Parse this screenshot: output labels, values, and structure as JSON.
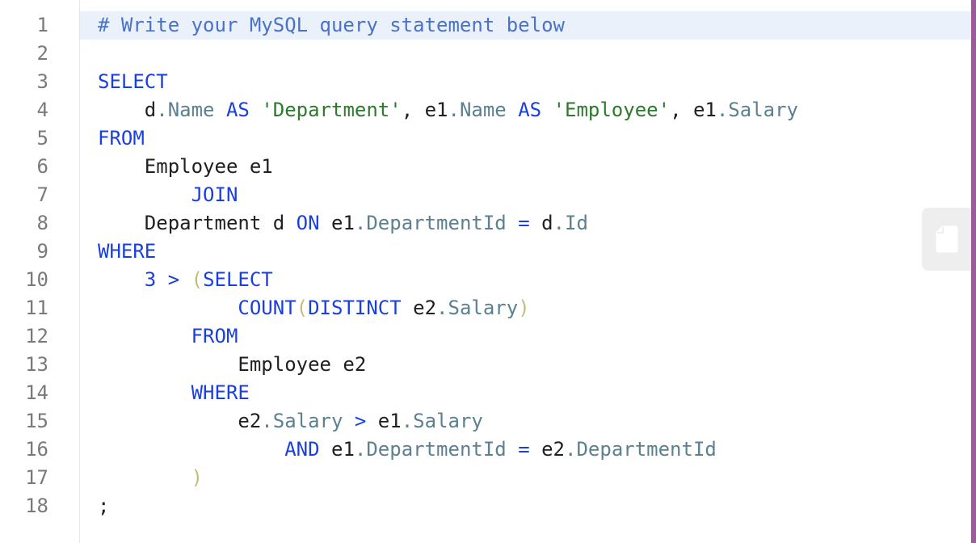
{
  "editor": {
    "language": "MySQL",
    "active_line": 1,
    "lines": [
      [
        {
          "t": "# Write your MySQL query statement below",
          "c": "cmt"
        }
      ],
      [],
      [
        {
          "t": "SELECT",
          "c": "kw"
        }
      ],
      [
        {
          "t": "    d"
        },
        {
          "t": ".Name",
          "c": "fld"
        },
        {
          "t": " "
        },
        {
          "t": "AS",
          "c": "kw"
        },
        {
          "t": " "
        },
        {
          "t": "'Department'",
          "c": "str"
        },
        {
          "t": ", e1"
        },
        {
          "t": ".Name",
          "c": "fld"
        },
        {
          "t": " "
        },
        {
          "t": "AS",
          "c": "kw"
        },
        {
          "t": " "
        },
        {
          "t": "'Employee'",
          "c": "str"
        },
        {
          "t": ", e1"
        },
        {
          "t": ".Salary",
          "c": "fld"
        }
      ],
      [
        {
          "t": "FROM",
          "c": "kw"
        }
      ],
      [
        {
          "t": "    Employee e1"
        }
      ],
      [
        {
          "t": "        "
        },
        {
          "t": "JOIN",
          "c": "kw"
        }
      ],
      [
        {
          "t": "    Department d "
        },
        {
          "t": "ON",
          "c": "kw"
        },
        {
          "t": " e1"
        },
        {
          "t": ".DepartmentId",
          "c": "fld"
        },
        {
          "t": " "
        },
        {
          "t": "=",
          "c": "op"
        },
        {
          "t": " d"
        },
        {
          "t": ".Id",
          "c": "fld"
        }
      ],
      [
        {
          "t": "WHERE",
          "c": "kw"
        }
      ],
      [
        {
          "t": "    "
        },
        {
          "t": "3",
          "c": "num"
        },
        {
          "t": " "
        },
        {
          "t": ">",
          "c": "op"
        },
        {
          "t": " "
        },
        {
          "t": "(",
          "c": "par"
        },
        {
          "t": "SELECT",
          "c": "kw"
        }
      ],
      [
        {
          "t": "            "
        },
        {
          "t": "COUNT",
          "c": "kw"
        },
        {
          "t": "(",
          "c": "par"
        },
        {
          "t": "DISTINCT",
          "c": "kw"
        },
        {
          "t": " e2"
        },
        {
          "t": ".Salary",
          "c": "fld"
        },
        {
          "t": ")",
          "c": "par"
        }
      ],
      [
        {
          "t": "        "
        },
        {
          "t": "FROM",
          "c": "kw"
        }
      ],
      [
        {
          "t": "            Employee e2"
        }
      ],
      [
        {
          "t": "        "
        },
        {
          "t": "WHERE",
          "c": "kw"
        }
      ],
      [
        {
          "t": "            e2"
        },
        {
          "t": ".Salary",
          "c": "fld"
        },
        {
          "t": " "
        },
        {
          "t": ">",
          "c": "op"
        },
        {
          "t": " e1"
        },
        {
          "t": ".Salary",
          "c": "fld"
        }
      ],
      [
        {
          "t": "                "
        },
        {
          "t": "AND",
          "c": "kw"
        },
        {
          "t": " e1"
        },
        {
          "t": ".DepartmentId",
          "c": "fld"
        },
        {
          "t": " "
        },
        {
          "t": "=",
          "c": "op"
        },
        {
          "t": " e2"
        },
        {
          "t": ".DepartmentId",
          "c": "fld"
        }
      ],
      [
        {
          "t": "        "
        },
        {
          "t": ")",
          "c": "par"
        }
      ],
      [
        {
          "t": ";"
        }
      ]
    ]
  },
  "copy_button": {
    "icon": "copy-icon"
  }
}
